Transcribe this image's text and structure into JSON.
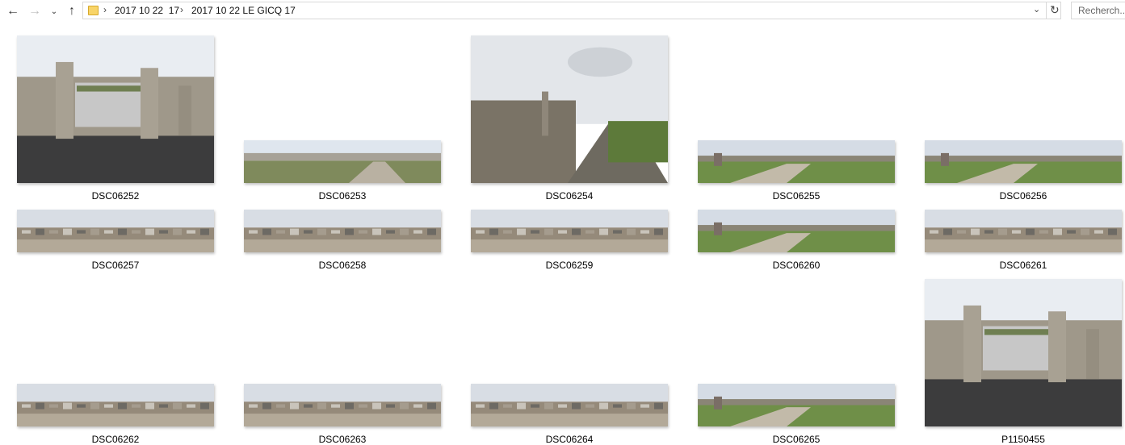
{
  "nav": {
    "back_icon": "back-arrow-icon",
    "forward_icon": "forward-arrow-icon",
    "recent_icon": "chevron-down-icon",
    "up_icon": "up-arrow-icon"
  },
  "breadcrumb": {
    "items": [
      "2017 10 22  17",
      "2017 10 22 LE GICQ 17"
    ]
  },
  "search": {
    "placeholder": "Recherch..."
  },
  "files": [
    {
      "name": "DSC06252",
      "kind": "gate"
    },
    {
      "name": "DSC06253",
      "kind": "path"
    },
    {
      "name": "DSC06254",
      "kind": "wall"
    },
    {
      "name": "DSC06255",
      "kind": "grass"
    },
    {
      "name": "DSC06256",
      "kind": "grass"
    },
    {
      "name": "DSC06257",
      "kind": "graves"
    },
    {
      "name": "DSC06258",
      "kind": "graves"
    },
    {
      "name": "DSC06259",
      "kind": "graves"
    },
    {
      "name": "DSC06260",
      "kind": "grass"
    },
    {
      "name": "DSC06261",
      "kind": "graves"
    },
    {
      "name": "DSC06262",
      "kind": "graves"
    },
    {
      "name": "DSC06263",
      "kind": "graves"
    },
    {
      "name": "DSC06264",
      "kind": "graves"
    },
    {
      "name": "DSC06265",
      "kind": "grass"
    },
    {
      "name": "P1150455",
      "kind": "gate"
    }
  ],
  "colors": {
    "folder": "#f8d468",
    "sky": "#dfe4ea",
    "ground": "#8a7f72",
    "grass": "#7d9a55"
  }
}
